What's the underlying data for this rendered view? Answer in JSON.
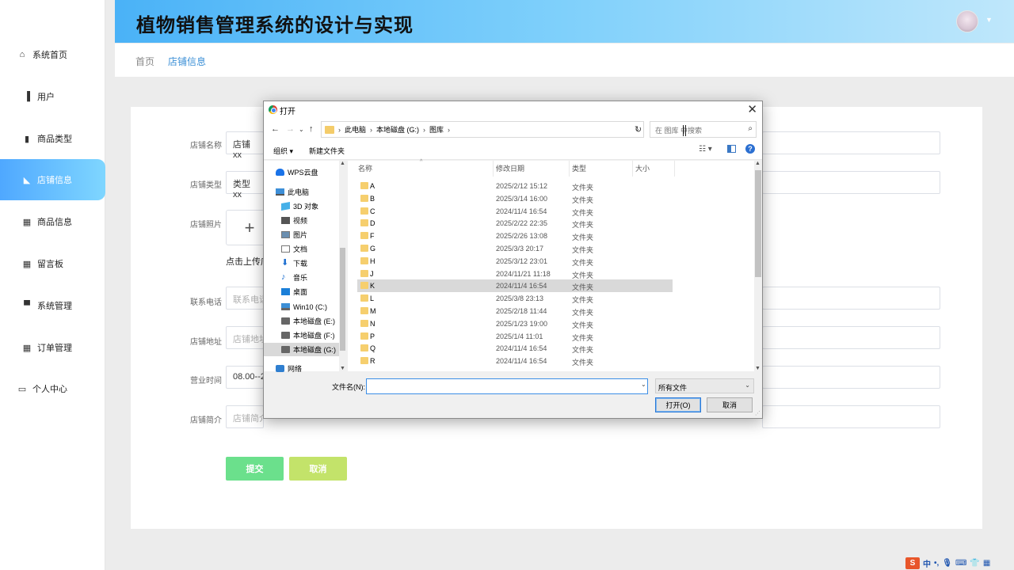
{
  "app": {
    "title": "植物销售管理系统的设计与实现"
  },
  "sidebar": {
    "items": [
      {
        "label": "系统首页",
        "icon": "home-icon"
      },
      {
        "label": "用户",
        "icon": "bar-chart-icon"
      },
      {
        "label": "商品类型",
        "icon": "clipboard-icon"
      },
      {
        "label": "店铺信息",
        "icon": "shop-icon"
      },
      {
        "label": "商品信息",
        "icon": "grid-icon"
      },
      {
        "label": "留言板",
        "icon": "grid-icon"
      },
      {
        "label": "系统管理",
        "icon": "monitor-icon"
      },
      {
        "label": "订单管理",
        "icon": "grid-icon"
      },
      {
        "label": "个人中心",
        "icon": "card-icon"
      }
    ],
    "active_index": 3,
    "active_color": "#4fa8ff"
  },
  "breadcrumb": {
    "home": "首页",
    "current": "店铺信息"
  },
  "form": {
    "shop_name": {
      "label": "店铺名称",
      "value": "店铺xx"
    },
    "shop_type": {
      "label": "店铺类型",
      "value": "类型xx"
    },
    "shop_photo": {
      "label": "店铺照片",
      "upload_tip": "点击上传店"
    },
    "phone": {
      "label": "联系电话",
      "placeholder": "联系电话"
    },
    "address": {
      "label": "店铺地址",
      "placeholder": "店铺地址"
    },
    "hours": {
      "label": "营业时间",
      "value": "08.00--2"
    },
    "intro": {
      "label": "店铺简介",
      "placeholder": "店铺简介"
    },
    "submit_label": "提交",
    "cancel_label": "取消",
    "submit_color": "#6be08c",
    "cancel_color": "#c3e36a"
  },
  "dialog": {
    "title": "打开",
    "path": [
      "此电脑",
      "本地磁盘 (G:)",
      "图库"
    ],
    "search_placeholder": "在 图库 中搜索",
    "toolbar": {
      "organize": "组织 ▾",
      "new_folder": "新建文件夹"
    },
    "nav": [
      {
        "label": "WPS云盘",
        "icon": "cloud-icon"
      },
      {
        "label": "此电脑",
        "icon": "computer-icon"
      },
      {
        "label": "3D 对象",
        "icon": "cube-icon"
      },
      {
        "label": "视频",
        "icon": "video-icon"
      },
      {
        "label": "图片",
        "icon": "picture-icon"
      },
      {
        "label": "文档",
        "icon": "document-icon"
      },
      {
        "label": "下载",
        "icon": "download-icon"
      },
      {
        "label": "音乐",
        "icon": "music-icon"
      },
      {
        "label": "桌面",
        "icon": "desktop-icon"
      },
      {
        "label": "Win10 (C:)",
        "icon": "drive-icon"
      },
      {
        "label": "本地磁盘 (E:)",
        "icon": "drive-icon"
      },
      {
        "label": "本地磁盘 (F:)",
        "icon": "drive-icon"
      },
      {
        "label": "本地磁盘 (G:)",
        "icon": "drive-icon"
      },
      {
        "label": "网络",
        "icon": "network-icon"
      }
    ],
    "nav_selected_index": 12,
    "columns": {
      "name": "名称",
      "modified": "修改日期",
      "type": "类型",
      "size": "大小"
    },
    "files": [
      {
        "name": "A",
        "date": "2025/2/12 15:12",
        "type": "文件夹"
      },
      {
        "name": "B",
        "date": "2025/3/14 16:00",
        "type": "文件夹"
      },
      {
        "name": "C",
        "date": "2024/11/4 16:54",
        "type": "文件夹"
      },
      {
        "name": "D",
        "date": "2025/2/22 22:35",
        "type": "文件夹"
      },
      {
        "name": "F",
        "date": "2025/2/26 13:08",
        "type": "文件夹"
      },
      {
        "name": "G",
        "date": "2025/3/3 20:17",
        "type": "文件夹"
      },
      {
        "name": "H",
        "date": "2025/3/12 23:01",
        "type": "文件夹"
      },
      {
        "name": "J",
        "date": "2024/11/21 11:18",
        "type": "文件夹"
      },
      {
        "name": "K",
        "date": "2024/11/4 16:54",
        "type": "文件夹"
      },
      {
        "name": "L",
        "date": "2025/3/8 23:13",
        "type": "文件夹"
      },
      {
        "name": "M",
        "date": "2025/2/18 11:44",
        "type": "文件夹"
      },
      {
        "name": "N",
        "date": "2025/1/23 19:00",
        "type": "文件夹"
      },
      {
        "name": "P",
        "date": "2025/1/4 11:01",
        "type": "文件夹"
      },
      {
        "name": "Q",
        "date": "2024/11/4 16:54",
        "type": "文件夹"
      },
      {
        "name": "R",
        "date": "2024/11/4 16:54",
        "type": "文件夹"
      }
    ],
    "files_selected_index": 8,
    "filename_label": "文件名(N):",
    "filename_value": "",
    "filetype_value": "所有文件",
    "open_label": "打开(O)",
    "cancel_label": "取消"
  },
  "tray": {
    "ime": "S",
    "lang": "中"
  }
}
